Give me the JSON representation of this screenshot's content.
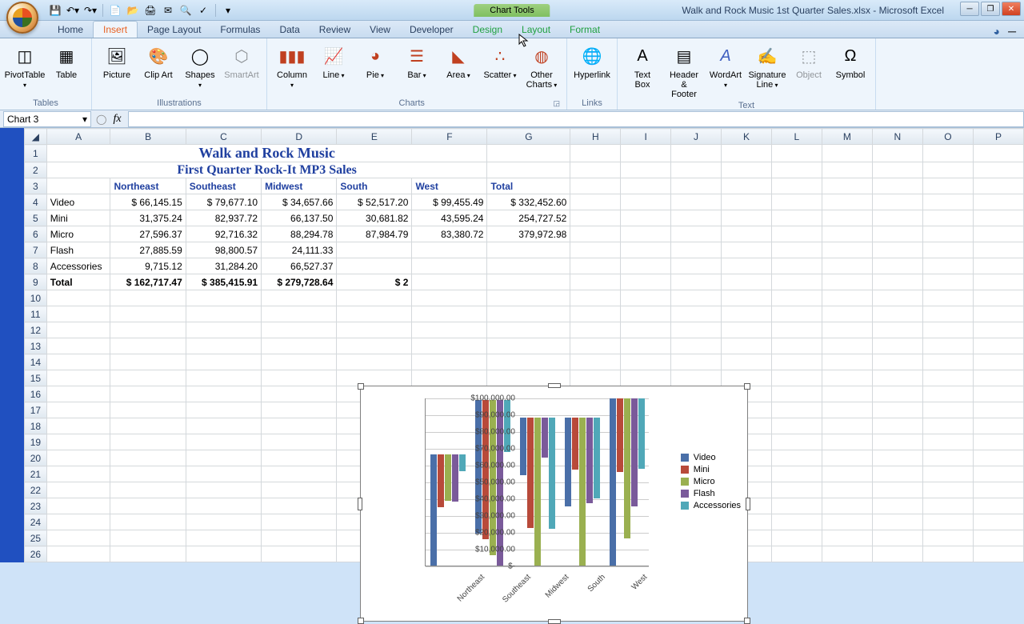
{
  "title_bar": {
    "chart_tools": "Chart Tools",
    "window_title": "Walk and Rock Music 1st Quarter Sales.xlsx - Microsoft Excel"
  },
  "tabs": {
    "home": "Home",
    "insert": "Insert",
    "page_layout": "Page Layout",
    "formulas": "Formulas",
    "data": "Data",
    "review": "Review",
    "view": "View",
    "developer": "Developer",
    "design": "Design",
    "layout": "Layout",
    "format": "Format"
  },
  "ribbon": {
    "tables": {
      "label": "Tables",
      "pivot": "PivotTable",
      "table": "Table"
    },
    "illustrations": {
      "label": "Illustrations",
      "picture": "Picture",
      "clipart": "Clip\nArt",
      "shapes": "Shapes",
      "smartart": "SmartArt"
    },
    "charts": {
      "label": "Charts",
      "column": "Column",
      "line": "Line",
      "pie": "Pie",
      "bar": "Bar",
      "area": "Area",
      "scatter": "Scatter",
      "other": "Other\nCharts"
    },
    "links": {
      "label": "Links",
      "hyperlink": "Hyperlink"
    },
    "text": {
      "label": "Text",
      "textbox": "Text\nBox",
      "header": "Header\n& Footer",
      "wordart": "WordArt",
      "sigline": "Signature\nLine",
      "object": "Object",
      "symbol": "Symbol"
    }
  },
  "namebox": "Chart 3",
  "sheet": {
    "cols": [
      "A",
      "B",
      "C",
      "D",
      "E",
      "F",
      "G",
      "H",
      "I",
      "J",
      "K",
      "L",
      "M",
      "N",
      "O",
      "P"
    ],
    "title1": "Walk and Rock Music",
    "title2": "First Quarter Rock-It MP3 Sales",
    "col_hdrs": [
      "",
      "Northeast",
      "Southeast",
      "Midwest",
      "South",
      "West",
      "Total"
    ],
    "rows": [
      {
        "label": "Video",
        "vals": [
          "$   66,145.15",
          "$   79,677.10",
          "$   34,657.66",
          "$   52,517.20",
          "$   99,455.49",
          "$   332,452.60"
        ]
      },
      {
        "label": "Mini",
        "vals": [
          "31,375.24",
          "82,937.72",
          "66,137.50",
          "30,681.82",
          "43,595.24",
          "254,727.52"
        ]
      },
      {
        "label": "Micro",
        "vals": [
          "27,596.37",
          "92,716.32",
          "88,294.78",
          "87,984.79",
          "83,380.72",
          "379,972.98"
        ]
      },
      {
        "label": "Flash",
        "vals": [
          "27,885.59",
          "98,800.57",
          "24,111.33",
          "",
          "",
          ""
        ]
      },
      {
        "label": "Accessories",
        "vals": [
          "9,715.12",
          "31,284.20",
          "66,527.37",
          "",
          "",
          ""
        ]
      },
      {
        "label": "Total",
        "vals": [
          "$ 162,717.47",
          "$ 385,415.91",
          "$ 279,728.64",
          "$ 2",
          "",
          ""
        ],
        "bold": true
      }
    ]
  },
  "chart_data": {
    "type": "bar",
    "categories": [
      "Northeast",
      "Southeast",
      "Midwest",
      "South",
      "West"
    ],
    "series": [
      {
        "name": "Video",
        "values": [
          66145,
          79677,
          34658,
          52517,
          99455
        ]
      },
      {
        "name": "Mini",
        "values": [
          31375,
          82938,
          66138,
          30682,
          43595
        ]
      },
      {
        "name": "Micro",
        "values": [
          27596,
          92716,
          88295,
          87985,
          83381
        ]
      },
      {
        "name": "Flash",
        "values": [
          27886,
          98801,
          24111,
          51000,
          64000
        ]
      },
      {
        "name": "Accessories",
        "values": [
          9715,
          31284,
          66527,
          48000,
          42000
        ]
      }
    ],
    "ylabel": "",
    "ylim": [
      0,
      100000
    ],
    "yticks": [
      "$-",
      "$10,000.00",
      "$20,000.00",
      "$30,000.00",
      "$40,000.00",
      "$50,000.00",
      "$60,000.00",
      "$70,000.00",
      "$80,000.00",
      "$90,000.00",
      "$100,000.00"
    ]
  }
}
